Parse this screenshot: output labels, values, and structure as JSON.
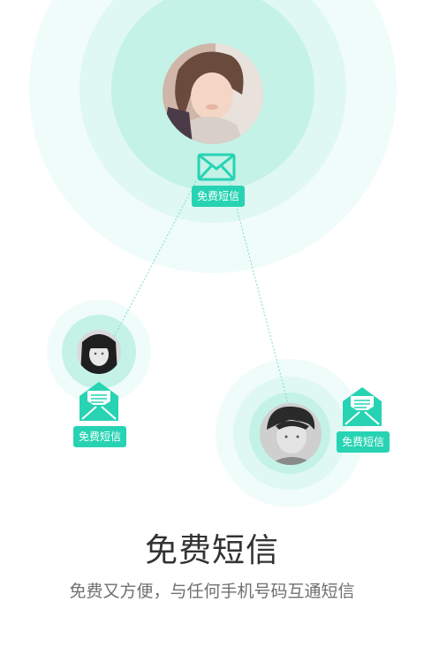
{
  "colors": {
    "accent": "#27d3b3",
    "ring_outer": "#f0fcf9",
    "ring_middle": "#dff8f2",
    "ring_inner": "#c4f2e7",
    "headline_text": "#333333",
    "subline_text": "#707070"
  },
  "contacts": [
    {
      "id": "top",
      "badge_label": "免费短信",
      "icon": "envelope-closed-icon",
      "avatar": "woman-smiling-avatar"
    },
    {
      "id": "left",
      "badge_label": "免费短信",
      "icon": "envelope-open-message-icon",
      "avatar": "woman-grayscale-avatar"
    },
    {
      "id": "right",
      "badge_label": "免费短信",
      "icon": "envelope-open-message-icon",
      "avatar": "man-grayscale-avatar"
    }
  ],
  "headline": "免费短信",
  "subline": "免费又方便，与任何手机号码互通短信"
}
